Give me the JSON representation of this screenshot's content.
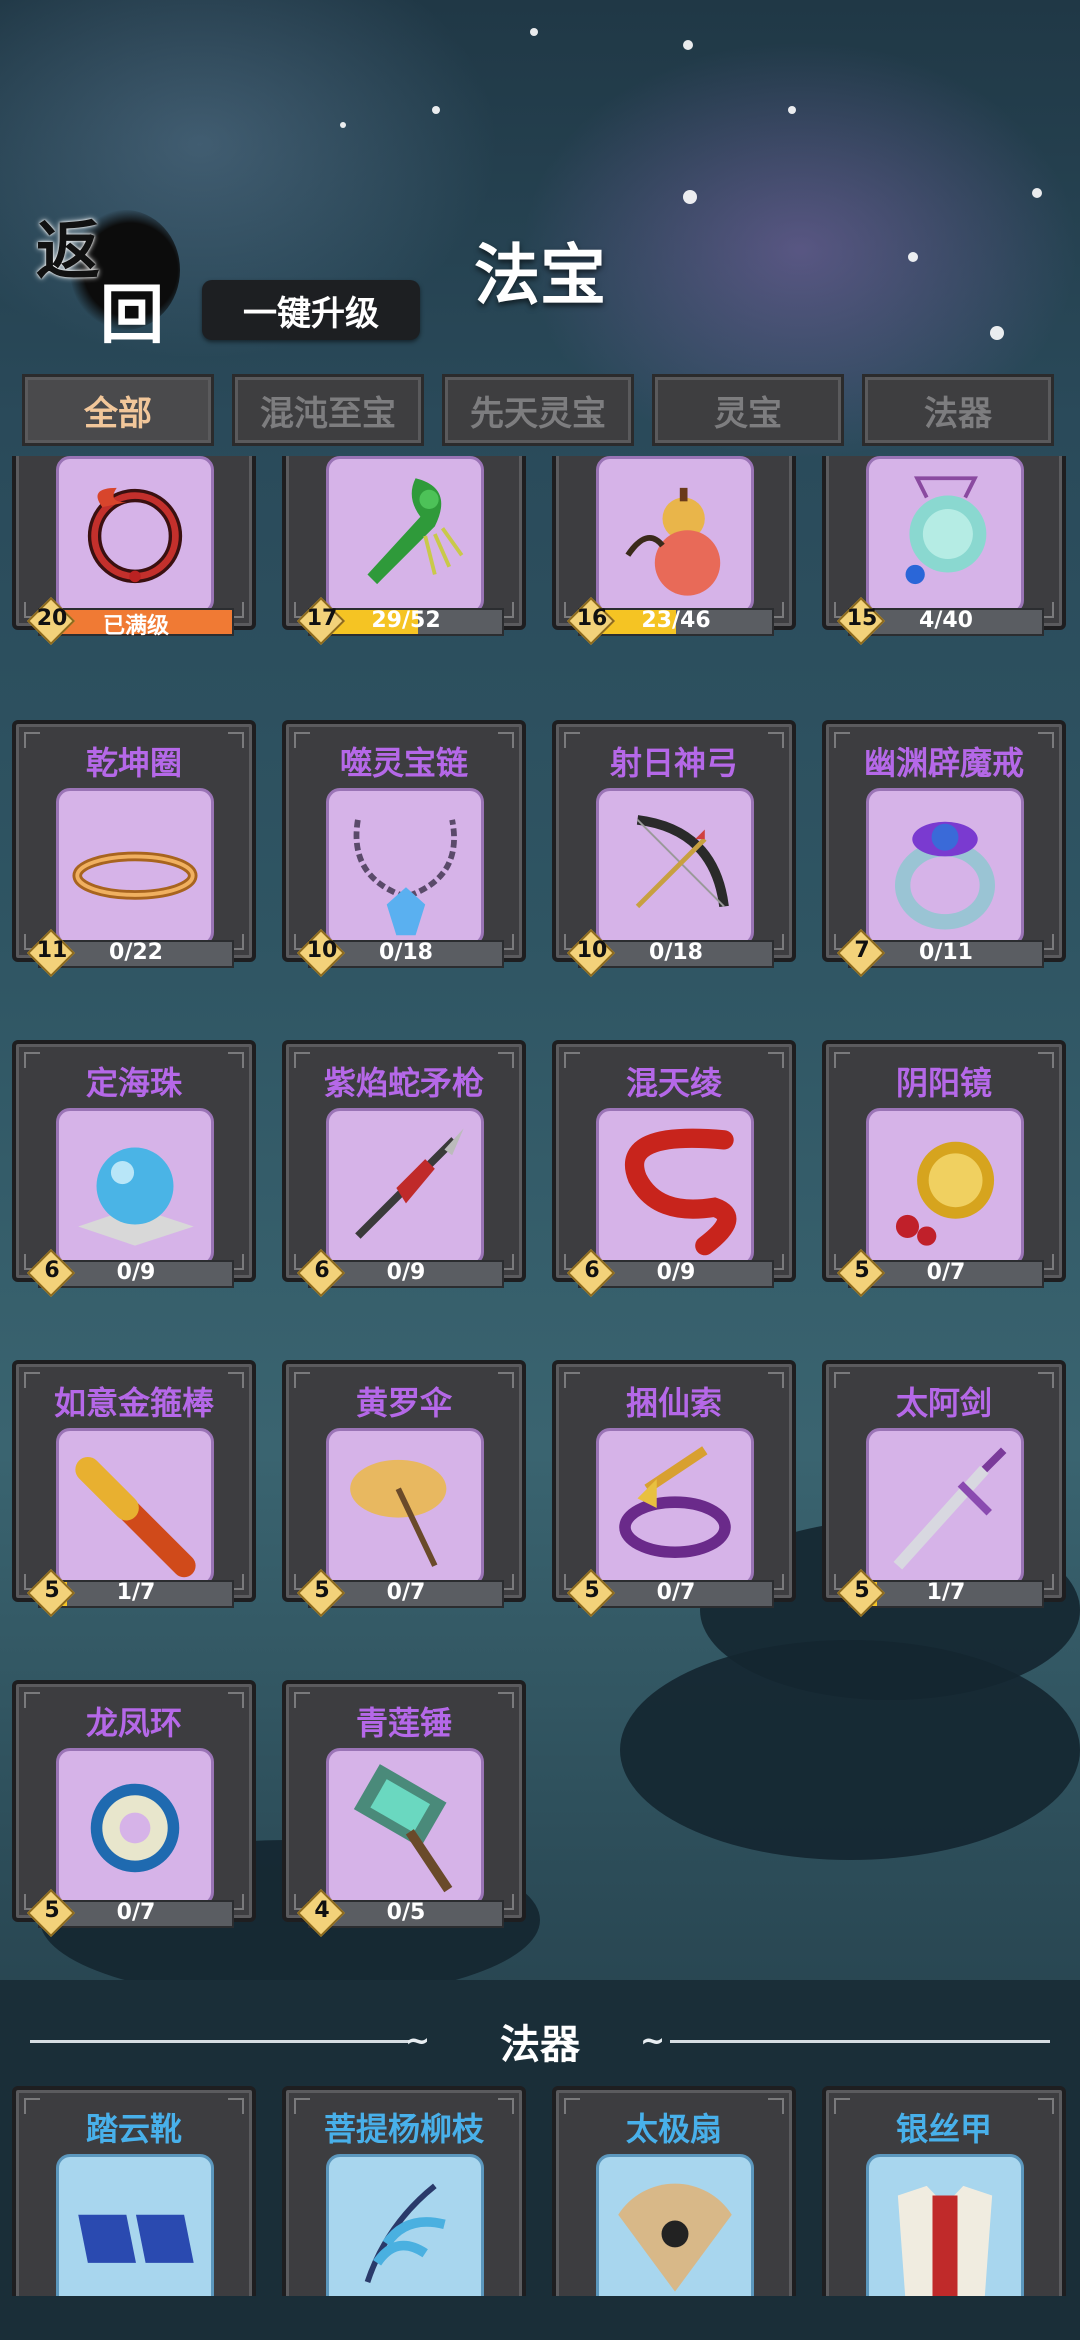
{
  "header": {
    "back_top": "返",
    "back_bottom": "回",
    "upgrade_all_label": "一键升级",
    "title": "法宝"
  },
  "tabs": [
    {
      "label": "全部",
      "active": true
    },
    {
      "label": "混沌至宝",
      "active": false
    },
    {
      "label": "先天灵宝",
      "active": false
    },
    {
      "label": "灵宝",
      "active": false
    },
    {
      "label": "法器",
      "active": false
    }
  ],
  "treasures": [
    {
      "icon": "red-ring-icon",
      "level": "20",
      "progress": "已满级",
      "fill": 1.0
    },
    {
      "icon": "jade-ruyi-icon",
      "level": "17",
      "progress": "29/52",
      "fill": 0.56
    },
    {
      "icon": "gourd-icon",
      "level": "16",
      "progress": "23/46",
      "fill": 0.5
    },
    {
      "icon": "jade-pendant-icon",
      "level": "15",
      "progress": "4/40",
      "fill": 0.1
    },
    {
      "name": "乾坤圈",
      "icon": "golden-hoop-icon",
      "level": "11",
      "progress": "0/22",
      "fill": 0
    },
    {
      "name": "噬灵宝链",
      "icon": "crystal-necklace-icon",
      "level": "10",
      "progress": "0/18",
      "fill": 0
    },
    {
      "name": "射日神弓",
      "icon": "bow-icon",
      "level": "10",
      "progress": "0/18",
      "fill": 0
    },
    {
      "name": "幽渊辟魔戒",
      "icon": "gem-ring-icon",
      "level": "7",
      "progress": "0/11",
      "fill": 0
    },
    {
      "name": "定海珠",
      "icon": "pearl-icon",
      "level": "6",
      "progress": "0/9",
      "fill": 0
    },
    {
      "name": "紫焰蛇矛枪",
      "icon": "spear-icon",
      "level": "6",
      "progress": "0/9",
      "fill": 0
    },
    {
      "name": "混天绫",
      "icon": "red-ribbon-icon",
      "level": "6",
      "progress": "0/9",
      "fill": 0
    },
    {
      "name": "阴阳镜",
      "icon": "mirror-icon",
      "level": "5",
      "progress": "0/7",
      "fill": 0
    },
    {
      "name": "如意金箍棒",
      "icon": "golden-staff-icon",
      "level": "5",
      "progress": "1/7",
      "fill": 0.14
    },
    {
      "name": "黄罗伞",
      "icon": "umbrella-icon",
      "level": "5",
      "progress": "0/7",
      "fill": 0
    },
    {
      "name": "捆仙索",
      "icon": "rope-icon",
      "level": "5",
      "progress": "0/7",
      "fill": 0
    },
    {
      "name": "太阿剑",
      "icon": "sword-icon",
      "level": "5",
      "progress": "1/7",
      "fill": 0.14
    },
    {
      "name": "龙凤环",
      "icon": "dragon-ring-icon",
      "level": "5",
      "progress": "0/7",
      "fill": 0
    },
    {
      "name": "青莲锤",
      "icon": "hammer-icon",
      "level": "4",
      "progress": "0/5",
      "fill": 0
    }
  ],
  "section": {
    "title": "法器"
  },
  "artifacts": [
    {
      "name": "踏云靴",
      "icon": "boots-icon"
    },
    {
      "name": "菩提杨柳枝",
      "icon": "willow-branch-icon"
    },
    {
      "name": "太极扇",
      "icon": "fan-icon"
    },
    {
      "name": "银丝甲",
      "icon": "armor-icon"
    }
  ]
}
